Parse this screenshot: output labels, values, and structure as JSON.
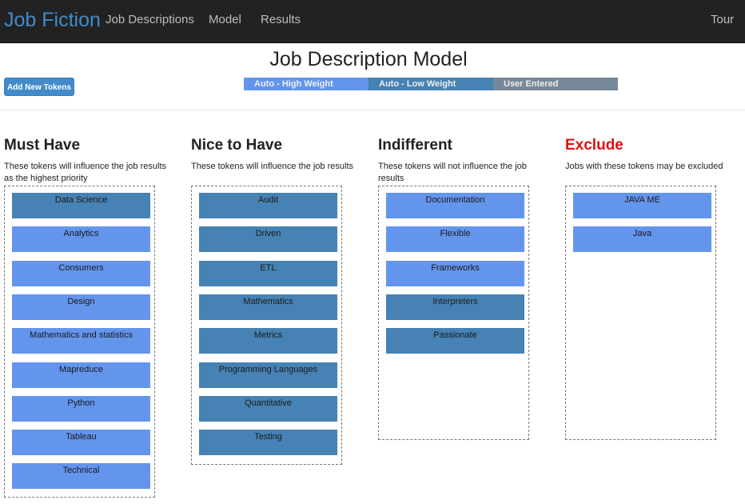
{
  "navbar": {
    "brand": "Job Fiction",
    "links": [
      "Job Descriptions",
      "Model",
      "Results"
    ],
    "tour": "Tour"
  },
  "page": {
    "title": "Job Description Model",
    "add_button": "Add New Tokens"
  },
  "legend": {
    "high": "Auto - High Weight",
    "low": "Auto - Low Weight",
    "user": "User Entered"
  },
  "colors": {
    "high_weight": "#6495ed",
    "low_weight": "#4682b4",
    "user_entered": "#778899",
    "exclude_title": "#e01010",
    "brand": "#428bca"
  },
  "columns": [
    {
      "title": "Must Have",
      "description": "These tokens will influence the job results as the highest priority",
      "tokens": [
        {
          "label": "Data Science",
          "weight": "low"
        },
        {
          "label": "Analytics",
          "weight": "high"
        },
        {
          "label": "Consumers",
          "weight": "high"
        },
        {
          "label": "Design",
          "weight": "high"
        },
        {
          "label": "Mathematics and statistics",
          "weight": "high"
        },
        {
          "label": "Mapreduce",
          "weight": "high"
        },
        {
          "label": "Python",
          "weight": "high"
        },
        {
          "label": "Tableau",
          "weight": "high"
        },
        {
          "label": "Technical",
          "weight": "high"
        }
      ]
    },
    {
      "title": "Nice to Have",
      "description": "These tokens will influence the job results",
      "tokens": [
        {
          "label": "Audit",
          "weight": "low"
        },
        {
          "label": "Driven",
          "weight": "low"
        },
        {
          "label": "ETL",
          "weight": "low"
        },
        {
          "label": "Mathematics",
          "weight": "low"
        },
        {
          "label": "Metrics",
          "weight": "low"
        },
        {
          "label": "Programming Languages",
          "weight": "low"
        },
        {
          "label": "Quantitative",
          "weight": "low"
        },
        {
          "label": "Testing",
          "weight": "low"
        }
      ]
    },
    {
      "title": "Indifferent",
      "description": "These tokens will not influence the job results",
      "tokens": [
        {
          "label": "Documentation",
          "weight": "high"
        },
        {
          "label": "Flexible",
          "weight": "high"
        },
        {
          "label": "Frameworks",
          "weight": "high"
        },
        {
          "label": "Interpreters",
          "weight": "low"
        },
        {
          "label": "Passionate",
          "weight": "low"
        }
      ]
    },
    {
      "title": "Exclude",
      "description": "Jobs with these tokens may be excluded",
      "tokens": [
        {
          "label": "JAVA ME",
          "weight": "high"
        },
        {
          "label": "Java",
          "weight": "high"
        }
      ]
    }
  ]
}
